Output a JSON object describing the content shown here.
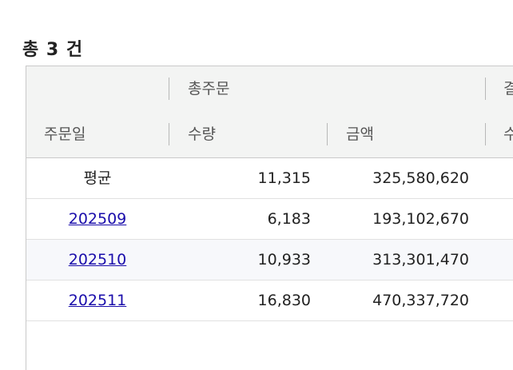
{
  "summary": {
    "total_label": "총 3 건"
  },
  "table": {
    "group_headers": {
      "total_orders": "총주문",
      "next_group_partial": "결"
    },
    "column_headers": {
      "order_date": "주문일",
      "quantity": "수량",
      "amount": "금액",
      "next_partial": "수"
    },
    "rows": [
      {
        "order_date": "평균",
        "quantity": "11,315",
        "amount": "325,580,620"
      },
      {
        "order_date": "202509",
        "quantity": "6,183",
        "amount": "193,102,670"
      },
      {
        "order_date": "202510",
        "quantity": "10,933",
        "amount": "313,301,470"
      },
      {
        "order_date": "202511",
        "quantity": "16,830",
        "amount": "470,337,720"
      }
    ]
  }
}
